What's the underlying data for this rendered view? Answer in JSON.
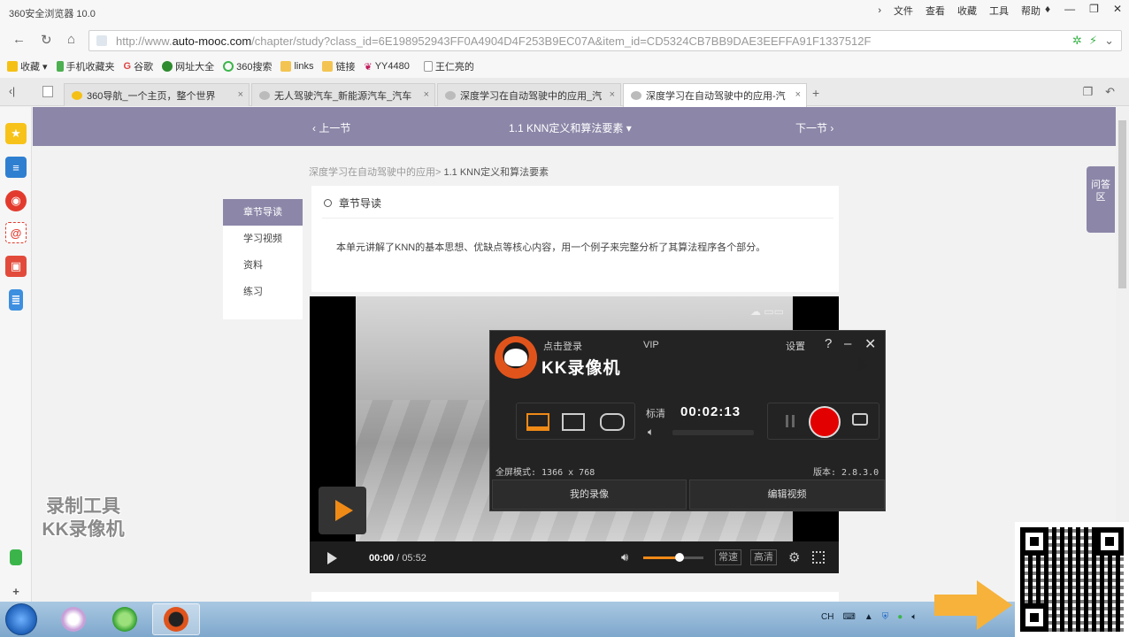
{
  "browser": {
    "title": "360安全浏览器 10.0",
    "menus": [
      "文件",
      "查看",
      "收藏",
      "工具",
      "帮助"
    ],
    "url_prefix": "http://www.",
    "url_domain": "auto-mooc.com",
    "url_path": "/chapter/study?class_id=6E198952943FF0A4904D4F253B9EC07A&item_id=CD5324CB7BB9DAE3EEFFA91F1337512F",
    "bookmarks": [
      "收藏",
      "手机收藏夹",
      "谷歌",
      "网址大全",
      "360搜索",
      "links",
      "链接",
      "YY4480",
      "王仁亮的"
    ],
    "tabs": [
      {
        "title": "360导航_一个主页，整个世界"
      },
      {
        "title": "无人驾驶汽车_新能源汽车_汽车"
      },
      {
        "title": "深度学习在自动驾驶中的应用_汽"
      },
      {
        "title": "深度学习在自动驾驶中的应用-汽"
      }
    ]
  },
  "course": {
    "prev_label": "上一节",
    "chapter_label": "1.1 KNN定义和算法要素",
    "next_label": "下一节",
    "breadcrumb_parent": "深度学习在自动驾驶中的应用>",
    "breadcrumb_current": "1.1 KNN定义和算法要素",
    "menu": [
      "章节导读",
      "学习视频",
      "资料",
      "练习"
    ],
    "guide_title": "章节导读",
    "guide_text": "本单元讲解了KNN的基本思想、优缺点等核心内容，用一个例子来完整分析了其算法程序各个部分。",
    "qa_label": "问答区"
  },
  "video": {
    "current_time": "00:00",
    "duration": "/ 05:52",
    "volume_level": 0.6,
    "quality_normal": "常速",
    "quality_hd": "高清"
  },
  "recorder": {
    "login": "点击登录",
    "vip": "VIP",
    "brand": "KK录像机",
    "settings": "设置",
    "help": "?",
    "quality": "标清",
    "timer": "00:02:13",
    "fullscreen_mode": "全屏模式: 1366 x 768",
    "version": "版本: 2.8.3.0",
    "my_recordings": "我的录像",
    "edit_video": "编辑视频"
  },
  "watermark": {
    "line1": "录制工具",
    "line2": "KK录像机"
  },
  "taskbar": {
    "tray_lang": "CH"
  }
}
